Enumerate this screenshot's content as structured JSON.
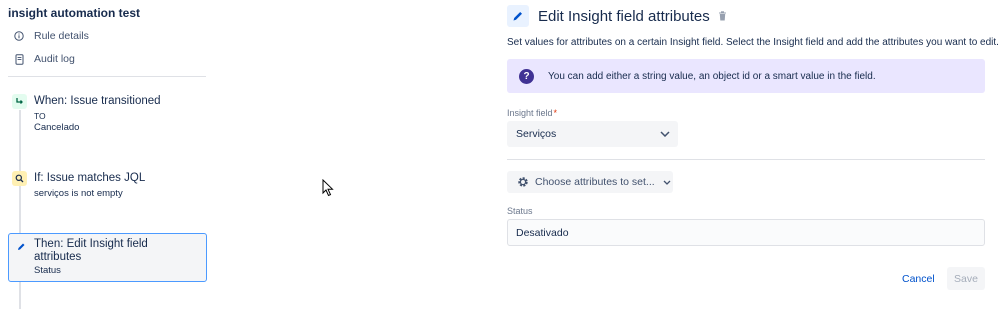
{
  "rule": {
    "title": "insight automation test",
    "nav": [
      {
        "label": "Rule details",
        "icon": "info-icon"
      },
      {
        "label": "Audit log",
        "icon": "document-icon"
      }
    ]
  },
  "steps": {
    "trigger": {
      "title": "When: Issue transitioned",
      "sub1": "TO",
      "sub2": "Cancelado",
      "icon": "transition-icon"
    },
    "condition": {
      "title": "If: Issue matches JQL",
      "sub": "serviços is not empty",
      "icon": "search-icon"
    },
    "action": {
      "title": "Then: Edit Insight field attributes",
      "sub": "Status",
      "icon": "pencil-icon"
    }
  },
  "panel": {
    "title": "Edit Insight field attributes",
    "description": "Set values for attributes on a certain Insight field. Select the Insight field and add the attributes you want to edit.",
    "info": "You can add either a string value, an object id or a smart value in the field.",
    "insight_field_label": "Insight field",
    "required_mark": "*",
    "insight_field_value": "Serviços",
    "choose_attributes_label": "Choose attributes to set...",
    "status_label": "Status",
    "status_value": "Desativado",
    "cancel_label": "Cancel",
    "save_label": "Save"
  },
  "colors": {
    "accent": "#0052cc",
    "selected_border": "#4c9aff",
    "info_bg": "#eae6ff",
    "info_icon": "#403294",
    "trigger_badge": "#e3fcef",
    "condition_badge": "#fff0b3"
  }
}
